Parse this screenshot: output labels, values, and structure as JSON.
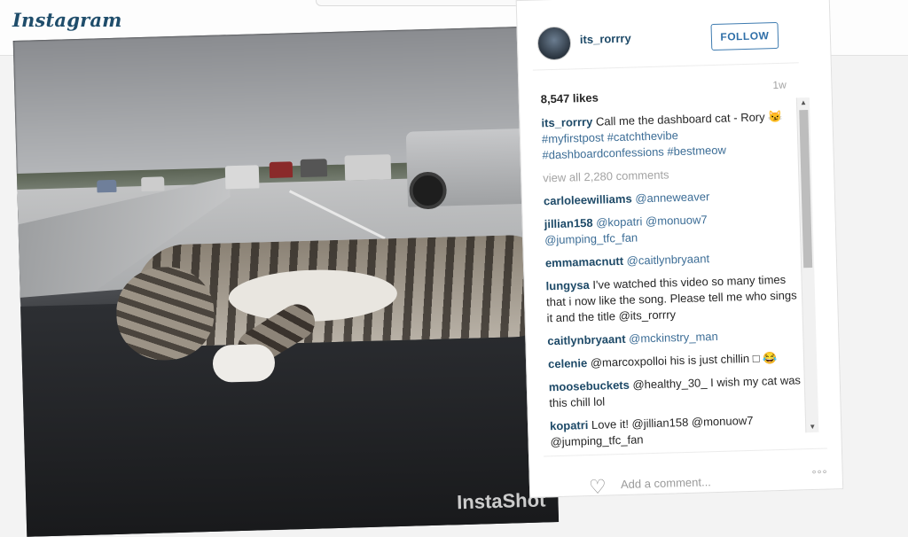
{
  "header": {
    "logo_text": "Instagram"
  },
  "post": {
    "username": "its_rorrry",
    "follow_label": "FOLLOW",
    "likes": "8,547 likes",
    "age": "1w",
    "watermark": "InstaShot",
    "caption": {
      "user": "its_rorrry",
      "text": "Call me the dashboard cat - Rory 😼",
      "hashtags": "#myfirstpost #catchthevibe #dashboardconfessions #bestmeow"
    },
    "view_all": "view all 2,280 comments",
    "comments": [
      {
        "user": "carloleewilliams",
        "text": "@anneweaver"
      },
      {
        "user": "jillian158",
        "text": "@kopatri @monuow7 @jumping_tfc_fan"
      },
      {
        "user": "emmamacnutt",
        "text": "@caitlynbryaant"
      },
      {
        "user": "lungysa",
        "text": "I've watched this video so many times that i now like the song. Please tell me who sings it and the title @its_rorrry"
      },
      {
        "user": "caitlynbryaant",
        "text": "@mckinstry_man"
      },
      {
        "user": "celenie",
        "text": "@marcoxpolloi his is just chillin □ 😂"
      },
      {
        "user": "moosebuckets",
        "text": "@healthy_30_ I wish my cat was this chill lol"
      },
      {
        "user": "kopatri",
        "text": "Love it! @jillian158 @monuow7 @jumping_tfc_fan"
      }
    ],
    "add_comment_placeholder": "Add a comment...",
    "more_label": "◦◦◦"
  },
  "icons": {
    "heart": "heart-icon",
    "more": "more-options-icon",
    "avatar": "avatar"
  }
}
